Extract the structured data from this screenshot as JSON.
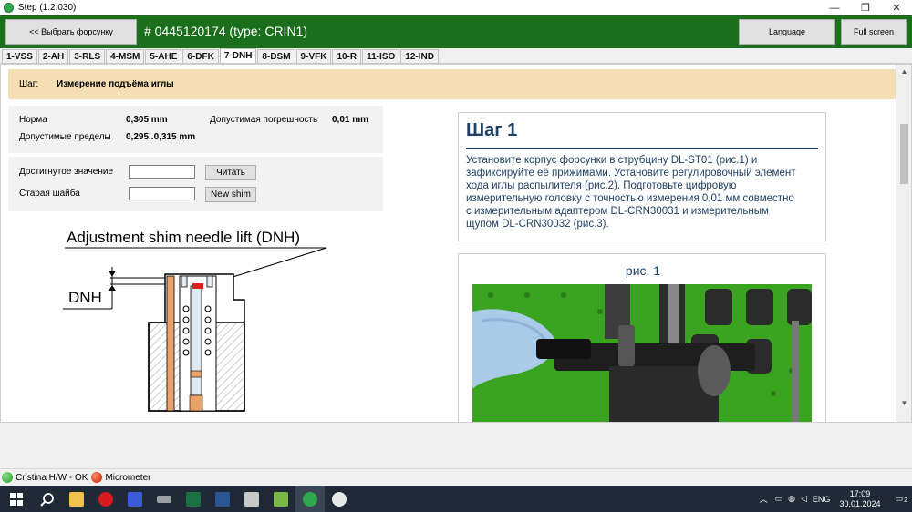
{
  "window": {
    "title": "Step (1.2.030)",
    "minimize": "—",
    "maximize": "❐",
    "close": "✕"
  },
  "header": {
    "back_label": "<< Выбрать форсунку",
    "injector": "# 0445120174 (type: CRIN1)",
    "language_label": "Language",
    "fullscreen_label": "Full screen"
  },
  "tabs": [
    {
      "label": "1-VSS"
    },
    {
      "label": "2-AH"
    },
    {
      "label": "3-RLS"
    },
    {
      "label": "4-MSM"
    },
    {
      "label": "5-AHE"
    },
    {
      "label": "6-DFK"
    },
    {
      "label": "7-DNH"
    },
    {
      "label": "8-DSM"
    },
    {
      "label": "9-VFK"
    },
    {
      "label": "10-R"
    },
    {
      "label": "11-ISO"
    },
    {
      "label": "12-IND"
    }
  ],
  "active_tab": "7-DNH",
  "step": {
    "label": "Шаг:",
    "name": "Измерение подъёма иглы"
  },
  "spec": {
    "norm_label": "Норма",
    "norm_value": "0,305 mm",
    "tol_label": "Допустимая погрешность",
    "tol_value": "0,01 mm",
    "limits_label": "Допустимые пределы",
    "limits_value": "0,295..0,315 mm"
  },
  "inputs": {
    "achieved_label": "Достигнутое значение",
    "achieved_value": "",
    "read_label": "Читать",
    "old_shim_label": "Старая шайба",
    "old_shim_value": "",
    "new_shim_label": "New shim"
  },
  "diagram": {
    "title": "Adjustment shim needle lift (DNH)",
    "dnh_label": "DNH"
  },
  "instruction": {
    "heading": "Шаг 1",
    "lines": [
      "Установите корпус форсунки в струбцину DL-ST01 (рис.1) и",
      "зафиксируйте её прижимами. Установите регулировочный элемент",
      "хода иглы распылителя (рис.2). Подготовьте цифровую",
      "измерительную головку с точностью измерения 0,01 мм совместно",
      "с измерительным адаптером DL-CRN30031 и измерительным",
      "щупом DL-CRN30032 (рис.3)."
    ]
  },
  "figure": {
    "caption": "рис. 1"
  },
  "status": {
    "hw_label": "Cristina H/W - OK",
    "device_label": "Micrometer"
  },
  "taskbar": {
    "lang": "ENG",
    "time": "17:09",
    "date": "30.01.2024",
    "notif_count": "2"
  }
}
